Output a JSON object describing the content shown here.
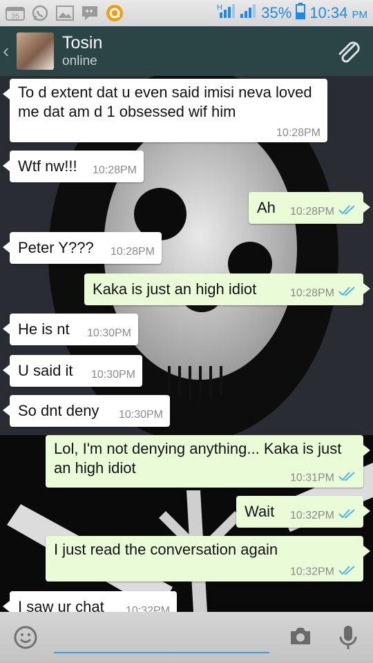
{
  "status_bar": {
    "calendar_day": "35",
    "battery_percent": "35%",
    "time": "10:34",
    "ampm": "PM",
    "network": "H",
    "icons": [
      "calendar-icon",
      "whatsapp-icon",
      "gallery-icon",
      "bbm-icon",
      "app-icon",
      "signal-icon",
      "battery-icon"
    ]
  },
  "header": {
    "name": "Tosin",
    "status": "online",
    "back_icon": "chevron-left-icon",
    "attach_icon": "paperclip-icon"
  },
  "messages": [
    {
      "dir": "in",
      "text": "To d extent dat u even said imisi neva loved me dat am d 1 obsessed wif him",
      "time": "10:28PM"
    },
    {
      "dir": "in",
      "text": "Wtf nw!!!",
      "time": "10:28PM"
    },
    {
      "dir": "out",
      "text": "Ah",
      "time": "10:28PM"
    },
    {
      "dir": "in",
      "text": "Peter  Y???",
      "time": "10:28PM"
    },
    {
      "dir": "out",
      "text": "Kaka is just an high idiot",
      "time": "10:28PM"
    },
    {
      "dir": "in",
      "text": "He is nt",
      "time": "10:30PM"
    },
    {
      "dir": "in",
      "text": "U said it",
      "time": "10:30PM"
    },
    {
      "dir": "in",
      "text": "So dnt deny",
      "time": "10:30PM"
    },
    {
      "dir": "out",
      "text": "Lol, I'm not denying anything... Kaka is just an high idiot",
      "time": "10:31PM"
    },
    {
      "dir": "out",
      "text": "Wait",
      "time": "10:32PM"
    },
    {
      "dir": "out",
      "text": "I just read the conversation again",
      "time": "10:32PM"
    },
    {
      "dir": "in",
      "text": "I saw ur chat",
      "time": "10:32PM"
    }
  ],
  "composer": {
    "emoji_icon": "emoji-icon",
    "camera_icon": "camera-icon",
    "mic_icon": "microphone-icon"
  },
  "colors": {
    "header_bg": "#2b4446",
    "incoming_bubble": "#ffffff",
    "outgoing_bubble": "#e9fcd7",
    "read_ticks": "#4fb3e8",
    "status_accent": "#1e88e5"
  }
}
